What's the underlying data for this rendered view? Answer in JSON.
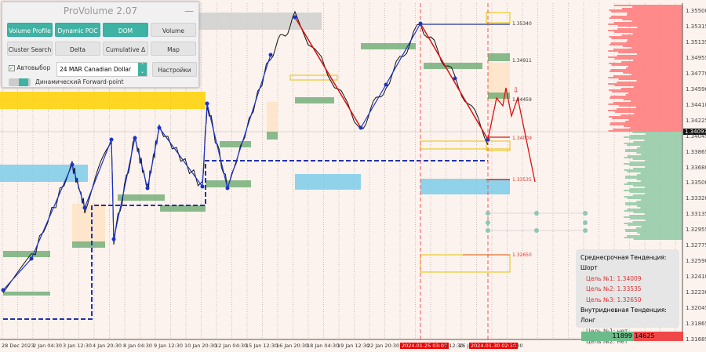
{
  "panel": {
    "title": "ProVolume 2.07",
    "minimize": "—",
    "buttons": [
      {
        "label": "Volume Profile",
        "active": true
      },
      {
        "label": "Dynamic POC",
        "active": true
      },
      {
        "label": "DOM",
        "active": true
      },
      {
        "label": "Volume",
        "active": false
      },
      {
        "label": "Cluster Search",
        "active": false
      },
      {
        "label": "Delta",
        "active": false
      },
      {
        "label": "Cumulative Δ",
        "active": false
      },
      {
        "label": "Map",
        "active": false
      }
    ],
    "autoselect_label": "Автовыбор",
    "autoselect_checked": true,
    "instrument": "24 MAR Canadian Dollar",
    "settings_label": "Настройки",
    "forward_point_label": "Динамический Forward-point"
  },
  "price_axis": [
    "1.35500",
    "1.35315",
    "1.35135",
    "1.34955",
    "1.34770",
    "1.34590",
    "1.34410",
    "1.34225",
    "1.34045",
    "1.33865",
    "1.33680",
    "1.33500",
    "1.33320",
    "1.33135",
    "1.32955",
    "1.32775",
    "1.32590",
    "1.32410",
    "1.32230",
    "1.32045",
    "1.31865",
    "1.31685"
  ],
  "current_price": "1.34093",
  "levels": [
    "1.35340",
    "1.34911",
    "1.34459",
    "1.34009",
    "1.33535",
    "1.32650"
  ],
  "dates": [
    "28 Dec 2023",
    "2 Jan 04:30",
    "3 Jan 12:30",
    "4 Jan 20:30",
    "8 Jan 04:30",
    "9 Jan 12:30",
    "10 Jan 20:30",
    "12 Jan 04:30",
    "15 Jan 12:30",
    "16 Jan 20:30",
    "18 Jan 04:30",
    "19 Jan 12:30",
    "22 Jan 20:30",
    "2024.01.25 03:00",
    "n 12:30",
    "26 Ja",
    "2024.01.30 02:30",
    "5:30"
  ],
  "info": {
    "mid_trend": "Среднесрочная Тенденция: Шорт",
    "mid_targets": [
      "Цель №1: 1.34009",
      "Цель №2: 1.33535",
      "Цель №3: 1.32650"
    ],
    "intraday_trend": "Внутридневная Тенденция: Лонг",
    "intraday_targets": [
      "Цель №1: нет",
      "Цель №2: нет"
    ]
  },
  "volume": {
    "buy": "11899",
    "sell": "14625"
  },
  "colors": {
    "teal": "#3fb3a3",
    "sell": "#f04848",
    "buy": "#6dbb8a",
    "zigzag": "#1a33cc",
    "forecast": "#dd1111"
  }
}
